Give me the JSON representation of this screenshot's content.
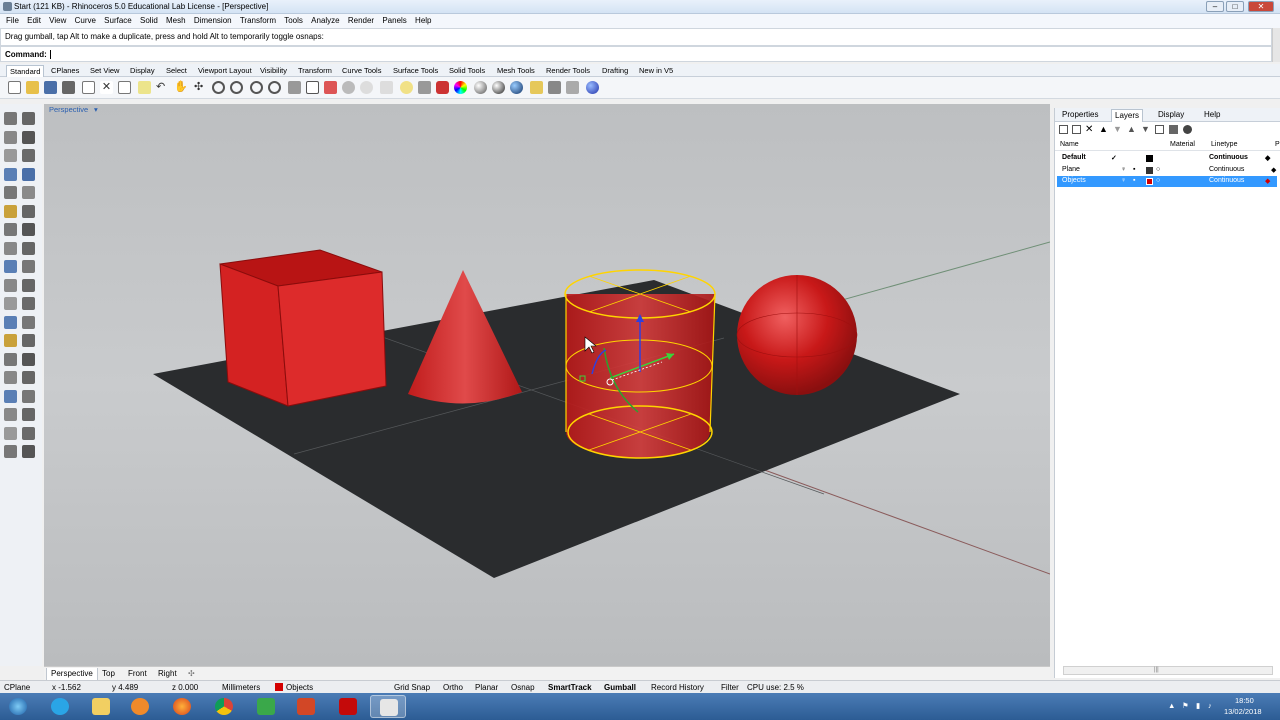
{
  "window": {
    "title": "Start (121 KB) - Rhinoceros 5.0 Educational Lab License - [Perspective]",
    "min_label": "–",
    "max_label": "□",
    "close_label": "✕"
  },
  "menu": [
    "File",
    "Edit",
    "View",
    "Curve",
    "Surface",
    "Solid",
    "Mesh",
    "Dimension",
    "Transform",
    "Tools",
    "Analyze",
    "Render",
    "Panels",
    "Help"
  ],
  "prompt": {
    "text": "Drag gumball, tap Alt to make a duplicate, press and hold Alt to temporarily toggle osnaps:",
    "command_label": "Command:"
  },
  "toolbar_tabs": [
    "Standard",
    "CPlanes",
    "Set View",
    "Display",
    "Select",
    "Viewport Layout",
    "Visibility",
    "Transform",
    "Curve Tools",
    "Surface Tools",
    "Solid Tools",
    "Mesh Tools",
    "Render Tools",
    "Drafting",
    "New in V5"
  ],
  "viewport": {
    "label": "Perspective",
    "dropdown_icon": "▾"
  },
  "viewport_tabs": [
    "Perspective",
    "Top",
    "Front",
    "Right"
  ],
  "viewport_tab_add": "✣",
  "panel": {
    "tabs": [
      "Properties",
      "Layers",
      "Display",
      "Help"
    ],
    "columns": {
      "name": "Name",
      "material": "Material",
      "linetype": "Linetype",
      "more": "P"
    },
    "layers": [
      {
        "name": "Default",
        "current": "✓",
        "linetype": "Continuous",
        "color": "#000000",
        "bold": true
      },
      {
        "name": "Plane",
        "current": "",
        "linetype": "Continuous",
        "color": "#333333",
        "bold": false
      },
      {
        "name": "Objects",
        "current": "",
        "linetype": "Continuous",
        "color": "#d40000",
        "bold": false
      }
    ],
    "scroll_grip": "|||"
  },
  "status": {
    "cplane": "CPlane",
    "x": "x -1.562",
    "y": "y 4.489",
    "z": "z 0.000",
    "units": "Millimeters",
    "layer": "Objects",
    "layer_color": "#d40000",
    "grid_snap": "Grid Snap",
    "ortho": "Ortho",
    "planar": "Planar",
    "osnap": "Osnap",
    "smarttrack": "SmartTrack",
    "gumball": "Gumball",
    "record_history": "Record History",
    "filter": "Filter",
    "cpu": "CPU use: 2.5 %"
  },
  "taskbar": {
    "time": "18:50",
    "date": "13/02/2018",
    "apps": [
      "start-orb",
      "internet-explorer",
      "file-explorer",
      "media-player",
      "firefox",
      "chrome",
      "recycle-app",
      "powerpoint",
      "acrobat",
      "rhino"
    ]
  },
  "colors": {
    "object_red": "#d42a2a",
    "selection_yellow": "#ffd400",
    "plane_dark": "#2a2c2e",
    "viewport_bg": "#c4c6c8"
  }
}
